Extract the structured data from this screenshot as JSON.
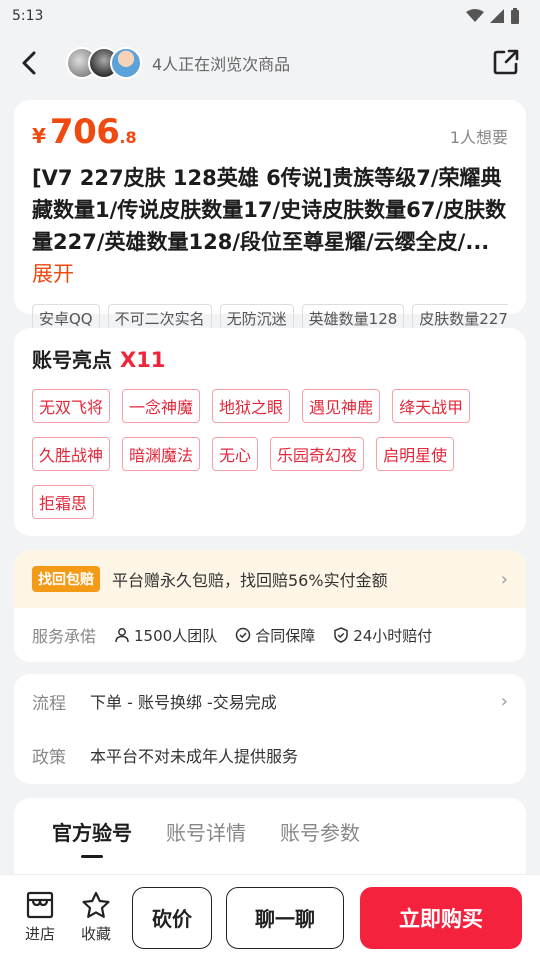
{
  "status_bar": {
    "time": "5:13"
  },
  "header": {
    "browsing_text": "4人正在浏览次商品"
  },
  "product": {
    "price_symbol": "¥",
    "price_int": "706",
    "price_dec": ".8",
    "wants": "1人想要",
    "title": "[V7 227皮肤 128英雄 6传说]贵族等级7/荣耀典藏数量1/传说皮肤数量17/史诗皮肤数量67/皮肤数量227/英雄数量128/段位至尊星耀/云缨全皮/...",
    "expand_label": "展开",
    "tags": [
      "安卓QQ",
      "不可二次实名",
      "无防沉迷",
      "英雄数量128",
      "皮肤数量227"
    ]
  },
  "highlights": {
    "title": "账号亮点",
    "count": "X11",
    "items": [
      "无双飞将",
      "一念神魔",
      "地狱之眼",
      "遇见神鹿",
      "绛天战甲",
      "久胜战神",
      "暗渊魔法",
      "无心",
      "乐园奇幻夜",
      "启明星使",
      "拒霜思"
    ]
  },
  "service": {
    "badge": "找回包赔",
    "guarantee_text": "平台赠永久包赔，找回赔56%实付金额",
    "commit_label": "服务承偌",
    "commit_items": [
      "1500人团队",
      "合同保障",
      "24小时赔付"
    ]
  },
  "flow": {
    "process_label": "流程",
    "process_value": "下单 - 账号换绑 -交易完成",
    "policy_label": "政策",
    "policy_value": "本平台不对未成年人提供服务"
  },
  "tabs": [
    "官方验号",
    "账号详情",
    "账号参数"
  ],
  "bottom_bar": {
    "shop_label": "进店",
    "fav_label": "收藏",
    "bargain_label": "砍价",
    "chat_label": "聊一聊",
    "buy_label": "立即购买"
  },
  "colors": {
    "price": "#f04a10",
    "accent_red": "#f5223e",
    "badge_orange": "#f39a17"
  }
}
